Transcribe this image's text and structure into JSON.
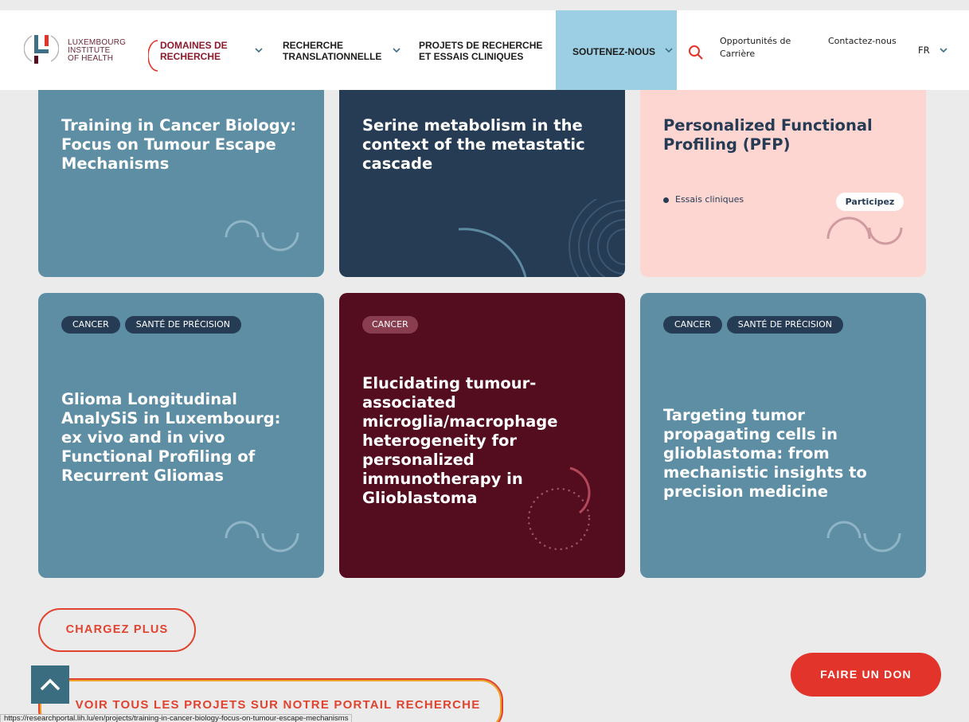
{
  "header": {
    "logo": {
      "line1": "LUXEMBOURG",
      "line2": "INSTITUTE",
      "line3": "OF HEALTH"
    },
    "nav": [
      {
        "line1": "DOMAINES DE",
        "line2": "RECHERCHE"
      },
      {
        "line1": "RECHERCHE",
        "line2": "TRANSLATIONNELLE"
      },
      {
        "line1": "PROJETS DE RECHERCHE",
        "line2": "ET ESSAIS CLINIQUES"
      },
      {
        "line1": "SOUTENEZ-NOUS"
      }
    ],
    "careers": {
      "line1": "Opportunités de",
      "line2": "Carrière"
    },
    "contact": "Contactez-nous",
    "language": "FR"
  },
  "cards": [
    {
      "title": "Training in Cancer Biology: Focus on Tumour Escape Mechanisms",
      "tags": []
    },
    {
      "title": "Serine metabolism in the context of the metastatic cascade",
      "tags": []
    },
    {
      "title": "Personalized Functional Profiling (PFP)",
      "tags": [],
      "category": "Essais cliniques",
      "action": "Participez"
    },
    {
      "title": "Glioma Longitudinal AnalySiS in Luxembourg: ex vivo and in vivo Functional Profiling of Recurrent Gliomas",
      "tags": [
        "CANCER",
        "SANTÉ DE PRÉCISION"
      ]
    },
    {
      "title": "Elucidating tumour-associated microglia/macrophage heterogeneity for personalized immunotherapy in Glioblastoma",
      "tags": [
        "CANCER"
      ]
    },
    {
      "title": "Targeting tumor propagating cells in glioblastoma: from mechanistic insights to precision medicine",
      "tags": [
        "CANCER",
        "SANTÉ DE PRÉCISION"
      ]
    }
  ],
  "buttons": {
    "load_more": "CHARGEZ PLUS",
    "view_all": "VOIR TOUS LES PROJETS SUR NOTRE PORTAIL RECHERCHE",
    "donate": "FAIRE UN DON"
  },
  "status_bar_url": "https://researchportal.lih.lu/en/projects/training-in-cancer-biology-focus-on-tumour-escape-mechanisms",
  "colors": {
    "steel_card": "#5e8ea4",
    "navy_card": "#263c55",
    "pink_card": "#fdd5d1",
    "wine_card": "#530d1f",
    "accent_red": "#e2342a",
    "nav_active_bg": "#9ccfe4"
  }
}
